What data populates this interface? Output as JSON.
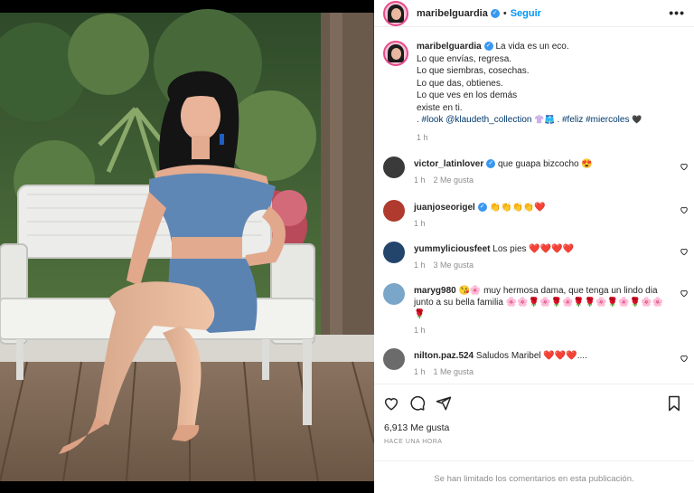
{
  "post": {
    "username": "maribelguardia",
    "follow_label": "Seguir",
    "more_label": "•••",
    "photo_alt": "Mujer sentada en banca blanca con conjunto de mezclilla"
  },
  "caption": {
    "username": "maribelguardia",
    "lines": [
      "La vida es un eco.",
      "Lo que envías, regresa.",
      "Lo que siembras, cosechas.",
      "Lo que das, obtienes.",
      "Lo que ves en los demás",
      "existe en ti."
    ],
    "tags_line": ". #look @klaudeth_collection",
    "tags_line_2": ". #feliz #miercoles",
    "time": "1 h"
  },
  "comments": [
    {
      "username": "victor_latinlover",
      "verified": true,
      "text": "que guapa bizcocho 😍",
      "time": "1 h",
      "likes": "2 Me gusta",
      "avatar_color": "#3a3a3a"
    },
    {
      "username": "juanjoseorigel",
      "verified": true,
      "text": "👏👏👏👏❤️",
      "time": "1 h",
      "likes": "",
      "avatar_color": "#b03a2e"
    },
    {
      "username": "yummyliciousfeet",
      "verified": false,
      "text": "Los pies ❤️❤️❤️❤️",
      "time": "1 h",
      "likes": "3 Me gusta",
      "avatar_color": "#24456b"
    },
    {
      "username": "maryg980",
      "verified": false,
      "text": "😘🌸 muy hermosa dama, que tenga un lindo dia junto a su bella familia 🌸🌸🌹🌸🌹🌸🌹🌹🌸🌹🌸🌹🌸🌸🌹",
      "time": "1 h",
      "likes": "",
      "avatar_color": "#7aa6c9"
    },
    {
      "username": "nilton.paz.524",
      "verified": false,
      "text": "Saludos Maribel ❤️❤️❤️....",
      "time": "1 h",
      "likes": "1 Me gusta",
      "avatar_color": "#6b6b6b"
    }
  ],
  "actions": {
    "likes": "6,913 Me gusta",
    "ago": "HACE UNA HORA",
    "limited_notice": "Se han limitado los comentarios en esta publicación."
  },
  "colors": {
    "accent": "#0095f6",
    "verified": "#3897f0",
    "muted": "#8e8e8e",
    "text": "#262626"
  },
  "icons": [
    "heart-icon",
    "comment-icon",
    "share-icon",
    "bookmark-icon",
    "more-icon",
    "verified-icon"
  ]
}
